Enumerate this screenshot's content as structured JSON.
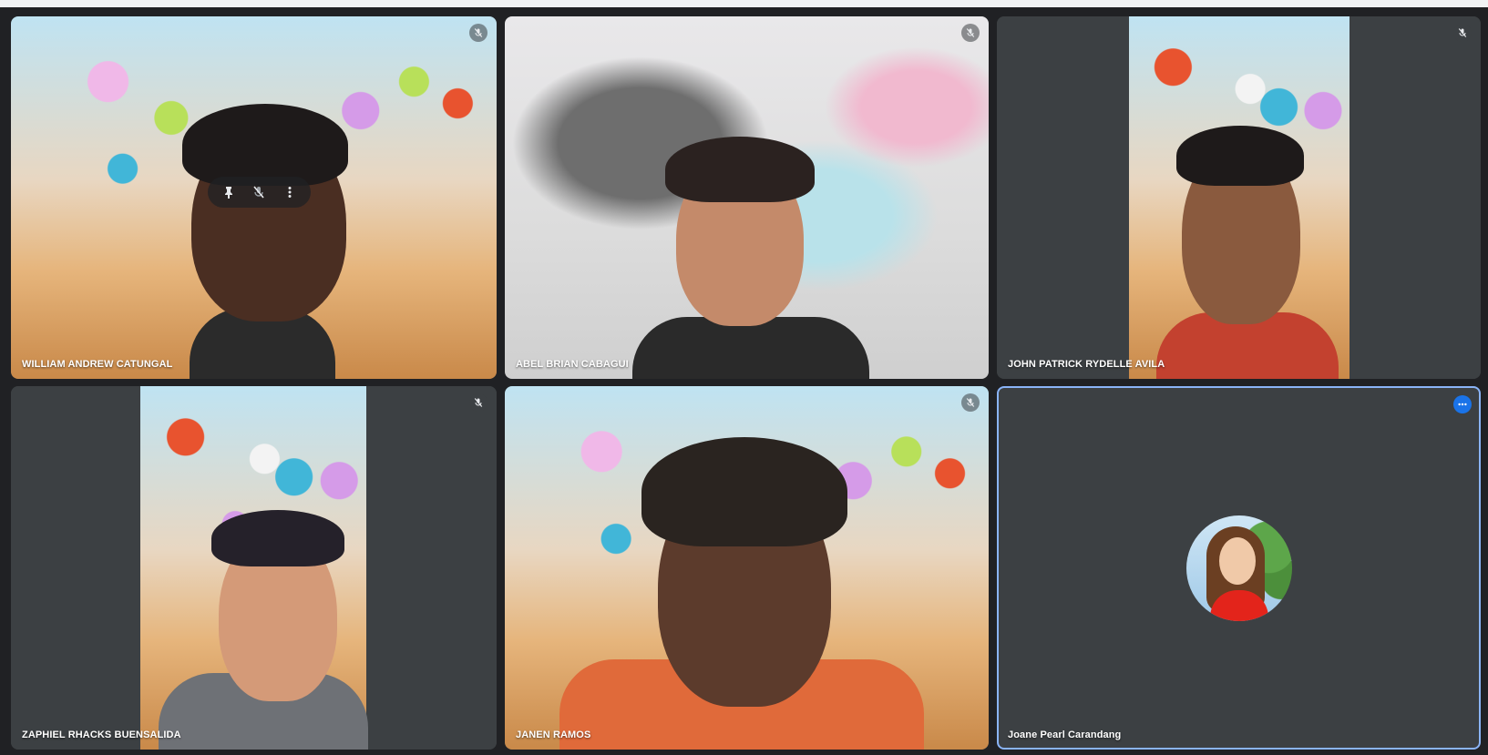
{
  "participants": [
    {
      "name": "WILLIAM ANDREW CATUNGAL",
      "muted": true,
      "background": "lantern-street"
    },
    {
      "name": "ABEL BRIAN CABAGUI",
      "muted": true,
      "background": "blur"
    },
    {
      "name": "JOHN PATRICK RYDELLE AVILA",
      "muted": true,
      "background": "lantern-street"
    },
    {
      "name": "ZAPHIEL RHACKS BUENSALIDA",
      "muted": true,
      "background": "lantern-street"
    },
    {
      "name": "JANEN RAMOS",
      "muted": true,
      "background": "lantern-street"
    },
    {
      "name": "Joane Pearl Carandang",
      "muted": false,
      "video_off": true,
      "selected": true
    }
  ],
  "hover_controls": {
    "icons": [
      "pin-icon",
      "mute-icon",
      "more-vert-icon"
    ]
  },
  "colors": {
    "stage_background": "#202124",
    "tile_background": "#3c4043",
    "selected_border": "#8ab4f8",
    "more_button": "#1a73e8"
  }
}
